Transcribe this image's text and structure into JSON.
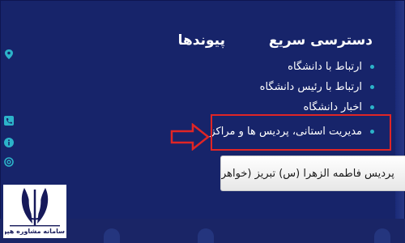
{
  "quick_access": {
    "heading": "دسترسی سریع",
    "items": [
      {
        "label": "ارتباط با دانشگاه"
      },
      {
        "label": "ارتباط با رئیس دانشگاه"
      },
      {
        "label": "اخبار دانشگاه"
      },
      {
        "label": "مدیریت استانی، پردیس ها و مراکز"
      }
    ],
    "highlighted_item": "مدیریت استانی، پردیس ها و مراکز"
  },
  "links": {
    "heading": "پیوندها"
  },
  "campus_button": {
    "label": "پردیس فاطمه الزهرا (س) تبریز (خواهر"
  },
  "side_icons": [
    "location-icon",
    "phone-icon",
    "info-icon",
    "email-icon"
  ],
  "logo": {
    "caption": "سامانه مشاوره هپوا"
  },
  "colors": {
    "background": "#17246a",
    "accent": "#2cb3c9",
    "highlight": "#e02525"
  }
}
